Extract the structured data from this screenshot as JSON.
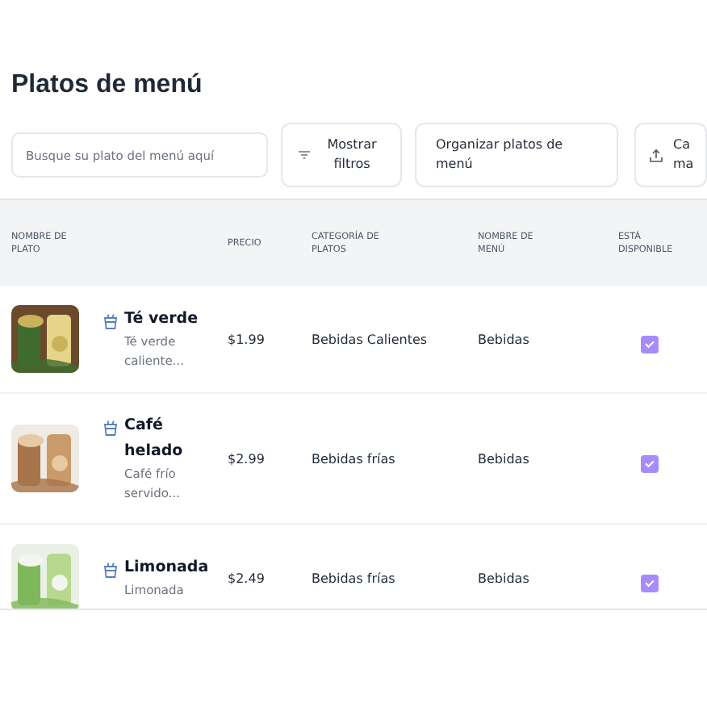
{
  "title": "Platos de menú",
  "toolbar": {
    "search": {
      "placeholder": "Busque su plato del menú aquí"
    },
    "buttons": [
      {
        "kind": "filter",
        "label": "Mostrar filtros"
      },
      {
        "kind": "plain",
        "label": "Organizar platos de menú"
      },
      {
        "kind": "upload",
        "label_lines": [
          "Ca",
          "ma"
        ]
      }
    ]
  },
  "table": {
    "columns": [
      "NOMBRE DE PLATO",
      "PRECIO",
      "CATEGORÍA DE PLATOS",
      "NOMBRE DE MENÚ",
      "ESTÁ DISPONIBLE"
    ],
    "rows": [
      {
        "name": "Té verde",
        "description": "Té verde caliente...",
        "price": "$1.99",
        "category": "Bebidas Calientes",
        "menu": "Bebidas",
        "available": true
      },
      {
        "name": "Café helado",
        "description": "Café frío servido...",
        "price": "$2.99",
        "category": "Bebidas frías",
        "menu": "Bebidas",
        "available": true
      },
      {
        "name": "Limonada",
        "description": "Limonada",
        "price": "$2.49",
        "category": "Bebidas frías",
        "menu": "Bebidas",
        "available": true
      }
    ]
  }
}
